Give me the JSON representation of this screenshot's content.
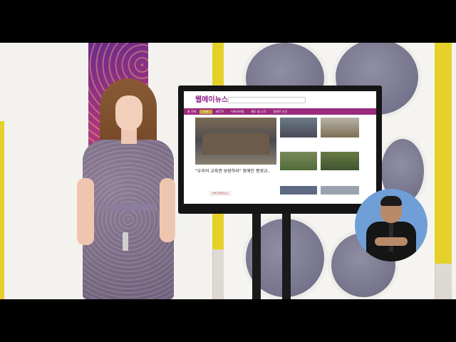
{
  "screen": {
    "logo": "웹메이뉴스",
    "search_placeholder": "",
    "nav": [
      "홈 전체",
      "뉴스",
      "제1TV",
      "이력서보험",
      "제도 청 소각",
      "알레르 신문"
    ],
    "headline": "\"우리의 교육권 보장하라\" 장애인 평생교..",
    "mbc_button": "MBC 장애인뉴스"
  }
}
